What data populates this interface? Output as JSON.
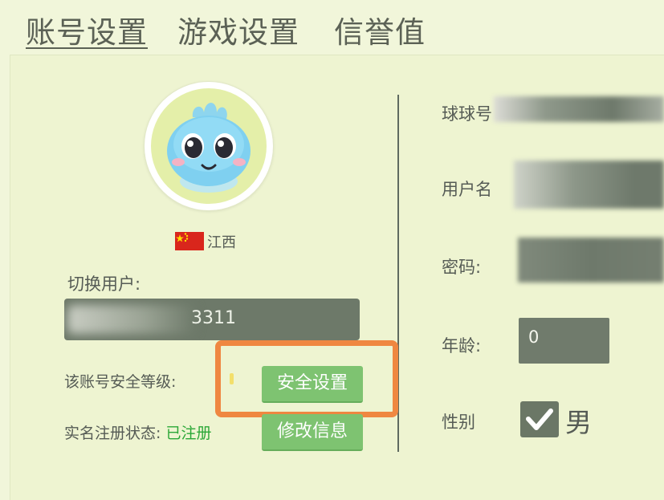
{
  "tabs": [
    {
      "label": "账号设置",
      "active": true
    },
    {
      "label": "游戏设置",
      "active": false
    },
    {
      "label": "信誉值",
      "active": false
    }
  ],
  "profile": {
    "region": "江西",
    "switch_user_label": "切换用户:",
    "selected_user": "3311",
    "security_level_label": "该账号安全等级:",
    "security_button": "安全设置",
    "realname_label": "实名注册状态:",
    "realname_value": "已注册",
    "edit_button": "修改信息"
  },
  "form": {
    "qiuqiu_id_label": "球球号",
    "username_label": "用户名",
    "password_label": "密码:",
    "age_label": "年龄:",
    "age_value": "0",
    "gender_label": "性别",
    "gender_value": "男",
    "gender_checked": true
  },
  "colors": {
    "background": "#f1f6da",
    "button_green": "#7ec371",
    "highlight_orange": "#ef8741",
    "status_green": "#2ba737",
    "field_gray": "#6e796b"
  }
}
